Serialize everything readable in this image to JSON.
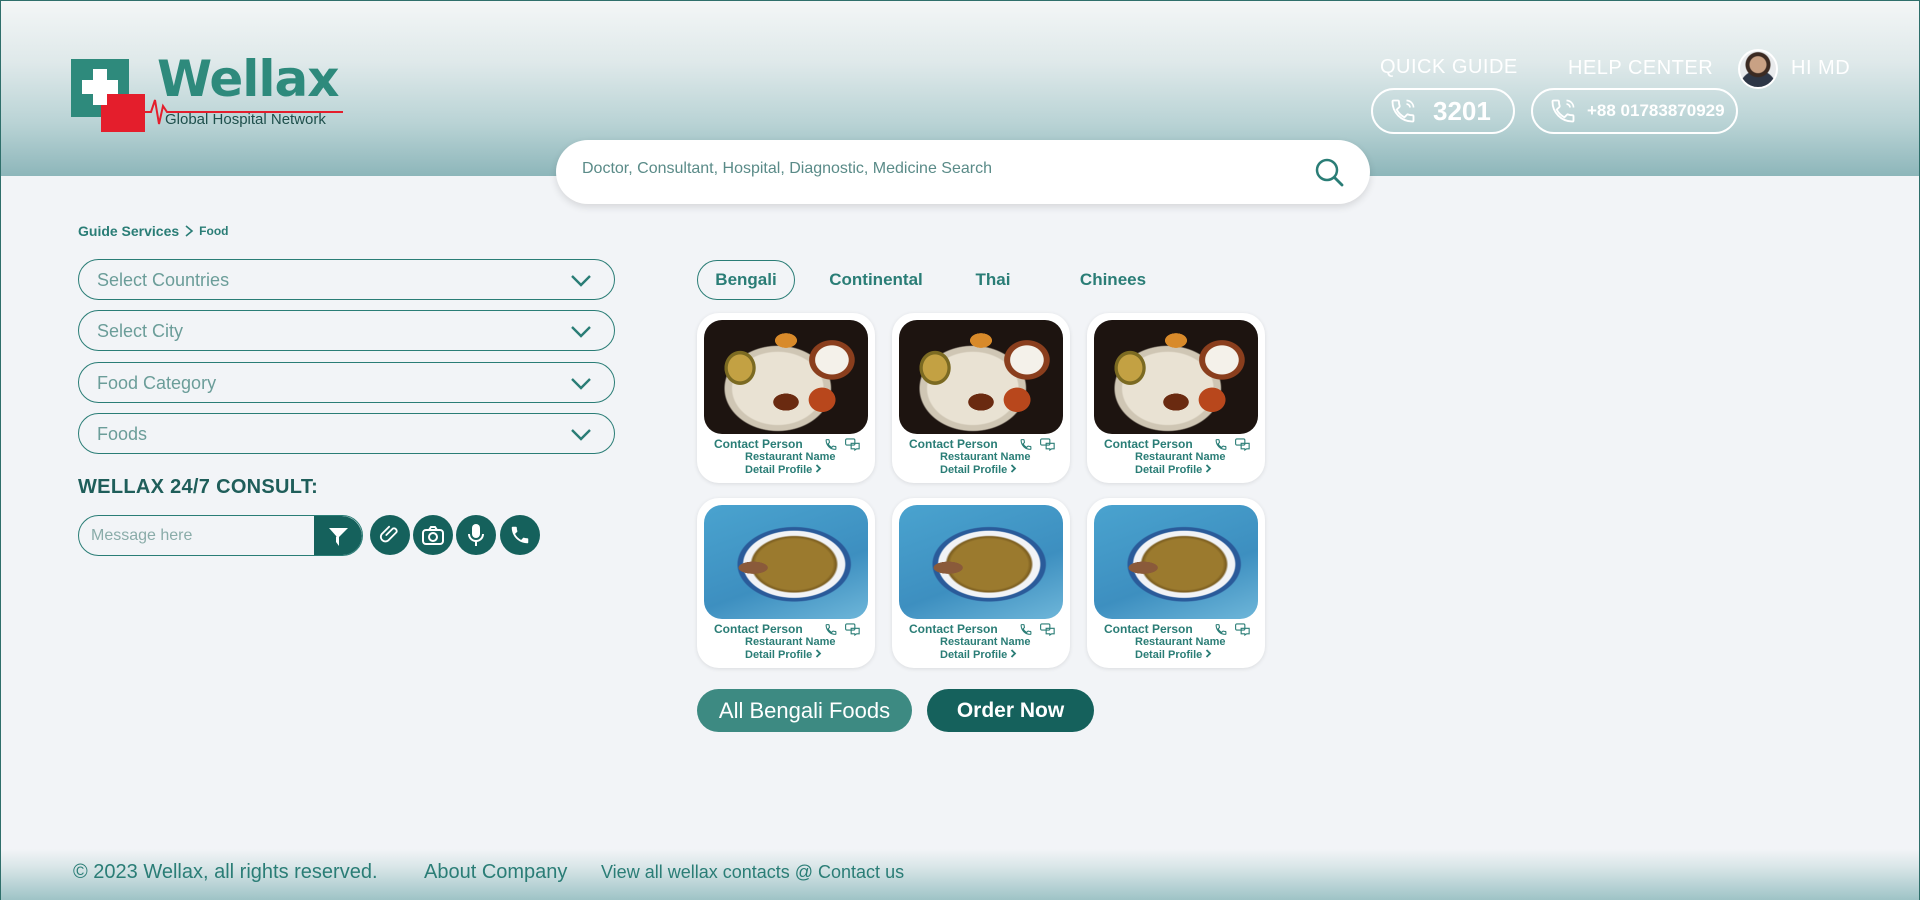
{
  "brand": {
    "name": "Wellax",
    "tagline": "Global Hospital Network"
  },
  "header": {
    "quick_guide": "QUICK GUIDE",
    "help_center": "HELP CENTER",
    "user_greeting": "HI MD",
    "quick_number": "3201",
    "help_number": "+88 01783870929"
  },
  "search": {
    "placeholder": "Doctor, Consultant, Hospital, Diagnostic, Medicine Search"
  },
  "breadcrumb": {
    "root": "Guide Services",
    "current": "Food"
  },
  "filters": [
    {
      "label": "Select Countries"
    },
    {
      "label": "Select City"
    },
    {
      "label": "Food Category"
    },
    {
      "label": "Foods"
    }
  ],
  "consult": {
    "title": "WELLAX 24/7 CONSULT:",
    "placeholder": "Message here"
  },
  "tabs": [
    {
      "label": "Bengali",
      "active": true
    },
    {
      "label": "Continental"
    },
    {
      "label": "Thai"
    },
    {
      "label": "Chinees"
    }
  ],
  "cards": [
    {
      "contact": "Contact Person",
      "restaurant": "Restaurant Name",
      "detail": "Detail Profile"
    },
    {
      "contact": "Contact Person",
      "restaurant": "Restaurant Name",
      "detail": "Detail Profile"
    },
    {
      "contact": "Contact Person",
      "restaurant": "Restaurant Name",
      "detail": "Detail Profile"
    },
    {
      "contact": "Contact Person",
      "restaurant": "Restaurant Name",
      "detail": "Detail Profile"
    },
    {
      "contact": "Contact Person",
      "restaurant": "Restaurant Name",
      "detail": "Detail Profile"
    },
    {
      "contact": "Contact Person",
      "restaurant": "Restaurant Name",
      "detail": "Detail Profile"
    }
  ],
  "actions": {
    "all_foods": "All Bengali Foods",
    "order_now": "Order Now"
  },
  "footer": {
    "copyright": "© 2023 Wellax, all rights reserved.",
    "about": "About Company",
    "contacts": "View all wellax contacts @ Contact us"
  },
  "colors": {
    "primary": "#2a7d76",
    "dark": "#15615c",
    "logo_red": "#e41e2c"
  }
}
